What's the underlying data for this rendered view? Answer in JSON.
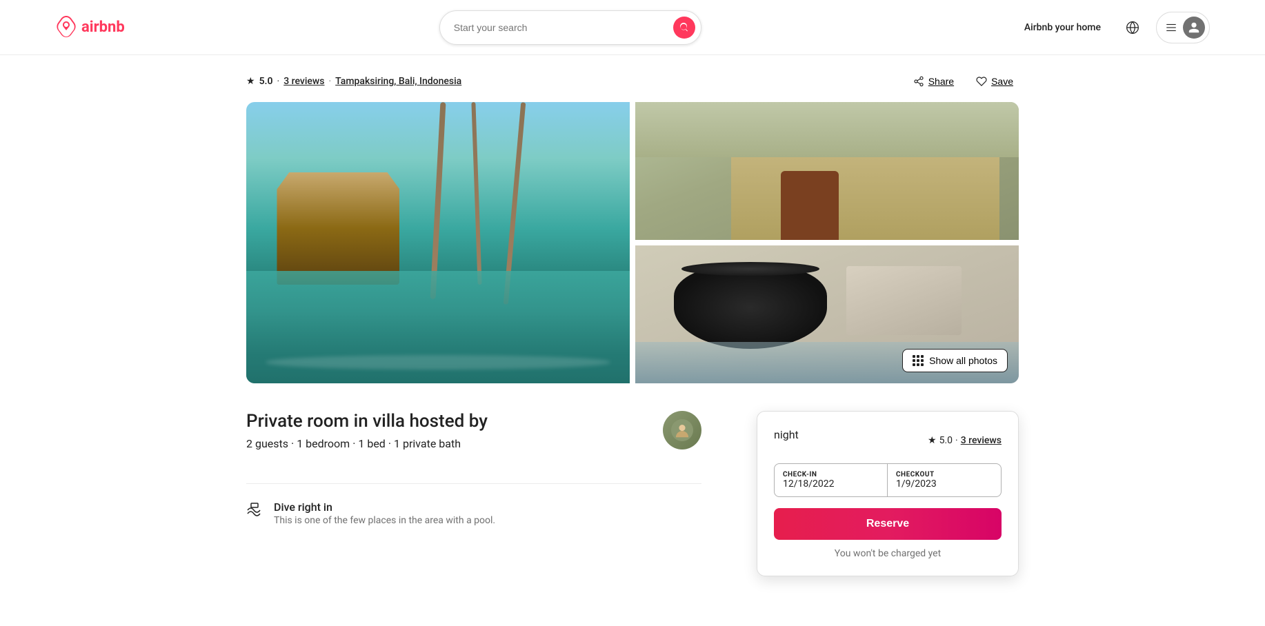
{
  "header": {
    "logo_text": "airbnb",
    "search_placeholder": "Start your search",
    "airbnb_your_home": "Airbnb your home"
  },
  "listing": {
    "rating": "5.0",
    "reviews_count": "3 reviews",
    "location": "Tampaksiring, Bali, Indonesia",
    "share_label": "Share",
    "save_label": "Save",
    "title": "Private room in villa hosted by",
    "guests": "2 guests",
    "bedrooms": "1 bedroom",
    "beds": "1 bed",
    "baths": "1 private bath",
    "feature1_title": "Dive right in",
    "feature1_desc": "This is one of the few places in the area with a pool.",
    "checkin_label": "CHECK-IN",
    "checkout_label": "CHECKOUT",
    "checkin_date": "12/18/2022",
    "checkout_date": "1/9/2023",
    "price_night_label": "night",
    "booking_rating": "5.0",
    "booking_reviews": "3 reviews",
    "reserve_label": "Reserve",
    "booking_note": "You won't be charged yet",
    "show_all_photos": "Show all photos"
  }
}
